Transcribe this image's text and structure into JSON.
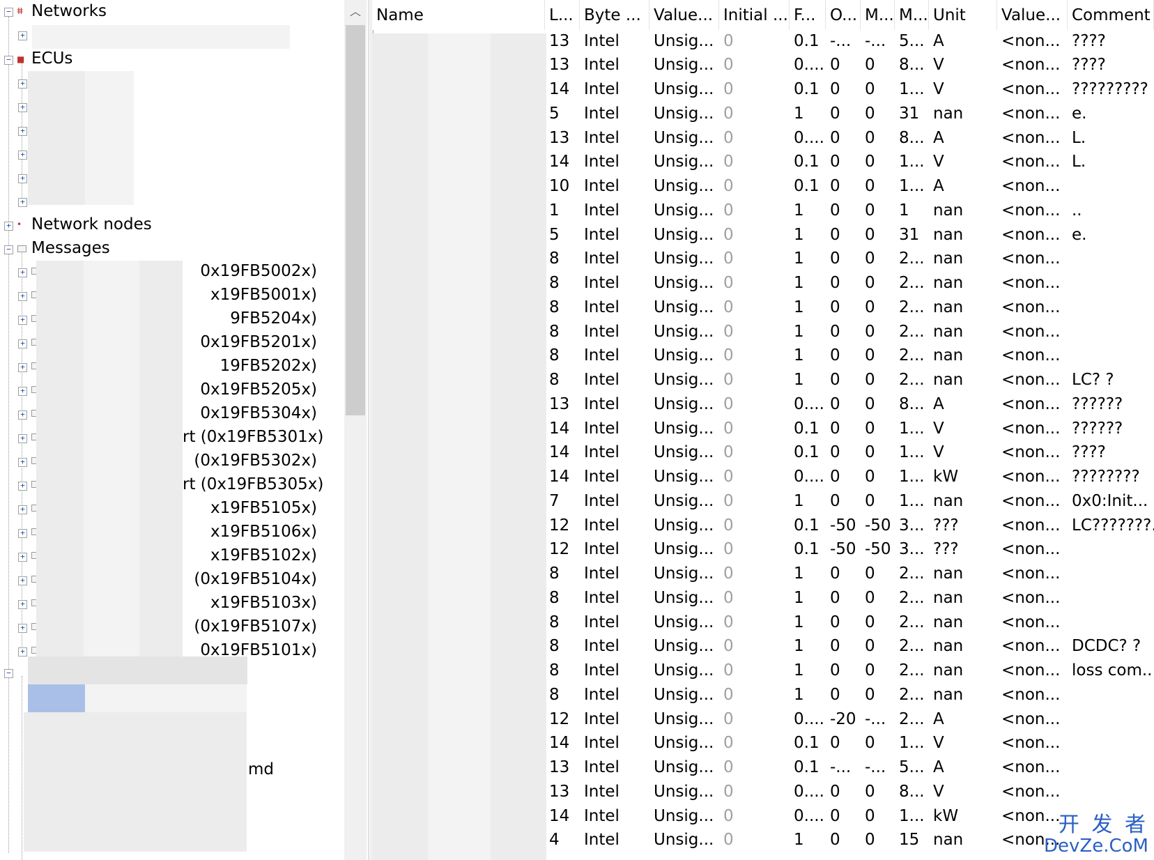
{
  "tree": {
    "roots": [
      {
        "label": "Networks",
        "expanded": true,
        "icon": "network-icon"
      },
      {
        "label": "ECUs",
        "expanded": true,
        "icon": "ecu-icon"
      },
      {
        "label": "Network nodes",
        "expanded": false,
        "icon": "network-node-icon"
      },
      {
        "label": "Messages",
        "expanded": true,
        "icon": "message-icon"
      }
    ],
    "messages": [
      "0x19FB5002x)",
      "x19FB5001x)",
      "9FB5204x)",
      "0x19FB5201x)",
      "19FB5202x)",
      "0x19FB5205x)",
      "0x19FB5304x)",
      "rt (0x19FB5301x)",
      "(0x19FB5302x)",
      "rt (0x19FB5305x)",
      "x19FB5105x)",
      "x19FB5106x)",
      "x19FB5102x)",
      "(0x19FB5104x)",
      "x19FB5103x)",
      "(0x19FB5107x)",
      "0x19FB5101x)"
    ],
    "partial_label": "md"
  },
  "grid": {
    "columns": [
      "Name",
      "L...",
      "Byte ...",
      "Value...",
      "Initial ...",
      "F...",
      "O...",
      "M...",
      "M...",
      "Unit",
      "Value...",
      "Comment"
    ],
    "rows": [
      [
        "13",
        "Intel",
        "Unsig...",
        "0",
        "0.1",
        "-...",
        "-...",
        "5...",
        "A",
        "<non...",
        "????"
      ],
      [
        "13",
        "Intel",
        "Unsig...",
        "0",
        "0....",
        "0",
        "0",
        "8...",
        "V",
        "<non...",
        "????"
      ],
      [
        "14",
        "Intel",
        "Unsig...",
        "0",
        "0.1",
        "0",
        "0",
        "1...",
        "V",
        "<non...",
        "?????????"
      ],
      [
        "5",
        "Intel",
        "Unsig...",
        "0",
        "1",
        "0",
        "0",
        "31",
        "nan",
        "<non...",
        "e."
      ],
      [
        "13",
        "Intel",
        "Unsig...",
        "0",
        "0....",
        "0",
        "0",
        "8...",
        "A",
        "<non...",
        "L."
      ],
      [
        "14",
        "Intel",
        "Unsig...",
        "0",
        "0.1",
        "0",
        "0",
        "1...",
        "V",
        "<non...",
        "L."
      ],
      [
        "10",
        "Intel",
        "Unsig...",
        "0",
        "0.1",
        "0",
        "0",
        "1...",
        "A",
        "<non...",
        ""
      ],
      [
        "1",
        "Intel",
        "Unsig...",
        "0",
        "1",
        "0",
        "0",
        "1",
        "nan",
        "<non...",
        ".."
      ],
      [
        "5",
        "Intel",
        "Unsig...",
        "0",
        "1",
        "0",
        "0",
        "31",
        "nan",
        "<non...",
        "e."
      ],
      [
        "8",
        "Intel",
        "Unsig...",
        "0",
        "1",
        "0",
        "0",
        "2...",
        "nan",
        "<non...",
        ""
      ],
      [
        "8",
        "Intel",
        "Unsig...",
        "0",
        "1",
        "0",
        "0",
        "2...",
        "nan",
        "<non...",
        ""
      ],
      [
        "8",
        "Intel",
        "Unsig...",
        "0",
        "1",
        "0",
        "0",
        "2...",
        "nan",
        "<non...",
        ""
      ],
      [
        "8",
        "Intel",
        "Unsig...",
        "0",
        "1",
        "0",
        "0",
        "2...",
        "nan",
        "<non...",
        ""
      ],
      [
        "8",
        "Intel",
        "Unsig...",
        "0",
        "1",
        "0",
        "0",
        "2...",
        "nan",
        "<non...",
        ""
      ],
      [
        "8",
        "Intel",
        "Unsig...",
        "0",
        "1",
        "0",
        "0",
        "2...",
        "nan",
        "<non...",
        "LC? ?"
      ],
      [
        "13",
        "Intel",
        "Unsig...",
        "0",
        "0....",
        "0",
        "0",
        "8...",
        "A",
        "<non...",
        "??????"
      ],
      [
        "14",
        "Intel",
        "Unsig...",
        "0",
        "0.1",
        "0",
        "0",
        "1...",
        "V",
        "<non...",
        "??????"
      ],
      [
        "14",
        "Intel",
        "Unsig...",
        "0",
        "0.1",
        "0",
        "0",
        "1...",
        "V",
        "<non...",
        "????"
      ],
      [
        "14",
        "Intel",
        "Unsig...",
        "0",
        "0....",
        "0",
        "0",
        "1...",
        "kW",
        "<non...",
        "????????"
      ],
      [
        "7",
        "Intel",
        "Unsig...",
        "0",
        "1",
        "0",
        "0",
        "1...",
        "nan",
        "<non...",
        "0x0:Init..."
      ],
      [
        "12",
        "Intel",
        "Unsig...",
        "0",
        "0.1",
        "-50",
        "-50",
        "3...",
        "???",
        "<non...",
        "LC???????."
      ],
      [
        "12",
        "Intel",
        "Unsig...",
        "0",
        "0.1",
        "-50",
        "-50",
        "3...",
        "???",
        "<non...",
        ""
      ],
      [
        "8",
        "Intel",
        "Unsig...",
        "0",
        "1",
        "0",
        "0",
        "2...",
        "nan",
        "<non...",
        ""
      ],
      [
        "8",
        "Intel",
        "Unsig...",
        "0",
        "1",
        "0",
        "0",
        "2...",
        "nan",
        "<non...",
        ""
      ],
      [
        "8",
        "Intel",
        "Unsig...",
        "0",
        "1",
        "0",
        "0",
        "2...",
        "nan",
        "<non...",
        ""
      ],
      [
        "8",
        "Intel",
        "Unsig...",
        "0",
        "1",
        "0",
        "0",
        "2...",
        "nan",
        "<non...",
        "DCDC? ?"
      ],
      [
        "8",
        "Intel",
        "Unsig...",
        "0",
        "1",
        "0",
        "0",
        "2...",
        "nan",
        "<non...",
        "loss com..."
      ],
      [
        "8",
        "Intel",
        "Unsig...",
        "0",
        "1",
        "0",
        "0",
        "2...",
        "nan",
        "<non...",
        ""
      ],
      [
        "12",
        "Intel",
        "Unsig...",
        "0",
        "0....",
        "-20",
        "-...",
        "2...",
        "A",
        "<non...",
        ""
      ],
      [
        "14",
        "Intel",
        "Unsig...",
        "0",
        "0.1",
        "0",
        "0",
        "1...",
        "V",
        "<non...",
        ""
      ],
      [
        "13",
        "Intel",
        "Unsig...",
        "0",
        "0.1",
        "-...",
        "-...",
        "5...",
        "A",
        "<non...",
        ""
      ],
      [
        "13",
        "Intel",
        "Unsig...",
        "0",
        "0....",
        "0",
        "0",
        "8...",
        "V",
        "<non...",
        ""
      ],
      [
        "14",
        "Intel",
        "Unsig...",
        "0",
        "0....",
        "0",
        "0",
        "1...",
        "kW",
        "<non...",
        ""
      ],
      [
        "4",
        "Intel",
        "Unsig...",
        "0",
        "1",
        "0",
        "0",
        "15",
        "nan",
        "<non...",
        ""
      ]
    ]
  },
  "watermark": {
    "line1": "开 发 者",
    "line2": "DevZe.CoM"
  },
  "colors": {
    "init_text": "#a0a0a0",
    "watermark": "#2a5fc4",
    "selection": "#a9bfe8"
  }
}
